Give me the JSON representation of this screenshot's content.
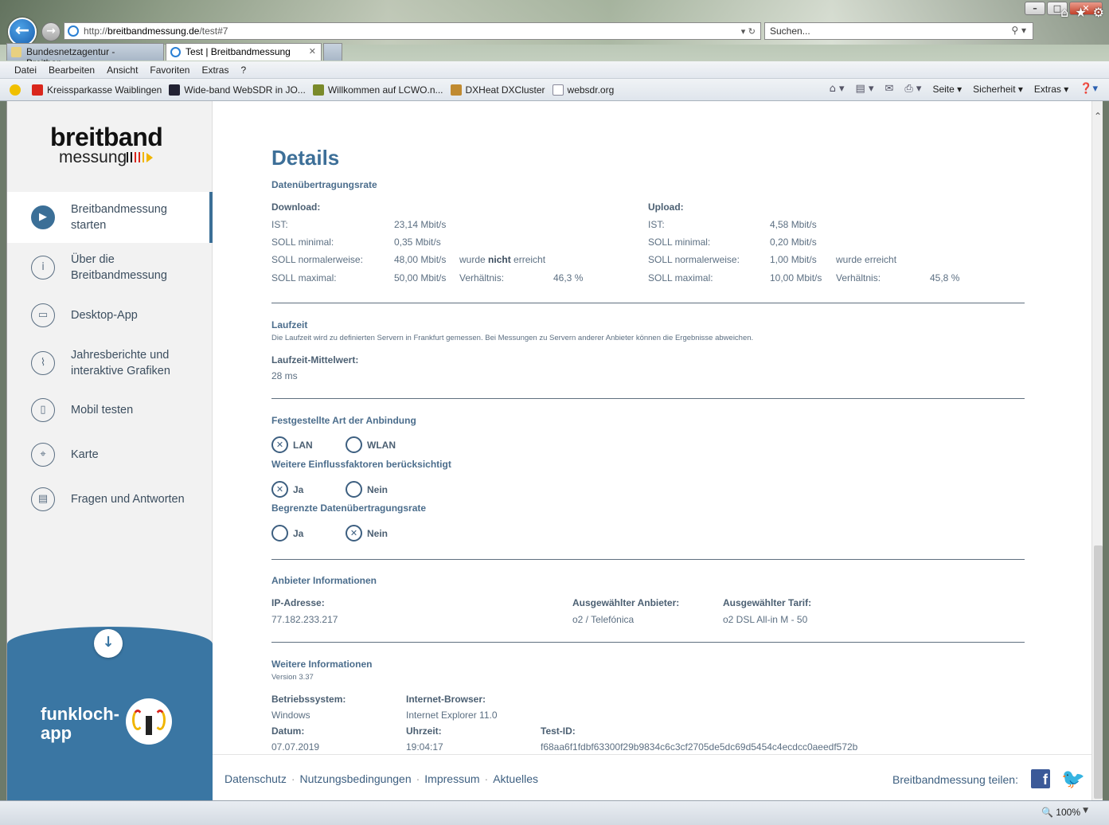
{
  "browser": {
    "url_prefix": "http://",
    "url_host": "breitbandmessung.de",
    "url_path": "/test#7",
    "search_placeholder": "Suchen...",
    "tabs": [
      {
        "label": "Bundesnetzagentur - Breitban...",
        "active": false
      },
      {
        "label": "Test | Breitbandmessung",
        "active": true
      }
    ],
    "menu": [
      "Datei",
      "Bearbeiten",
      "Ansicht",
      "Favoriten",
      "Extras",
      "?"
    ],
    "favorites": [
      "Kreissparkasse Waiblingen",
      "Wide-band WebSDR in JO...",
      "Willkommen auf LCWO.n...",
      "DXHeat  DXCluster",
      "websdr.org"
    ],
    "command_bar": [
      "Seite",
      "Sicherheit",
      "Extras"
    ],
    "zoom": "100%"
  },
  "sidebar": {
    "logo_top": "breitband",
    "logo_bottom": "messung",
    "items": [
      {
        "label1": "Breitbandmessung",
        "label2": "starten",
        "icon": "play-icon"
      },
      {
        "label1": "Über die",
        "label2": "Breitbandmessung",
        "icon": "info-icon"
      },
      {
        "label1": "Desktop-App",
        "label2": "",
        "icon": "monitor-icon"
      },
      {
        "label1": "Jahresberichte und",
        "label2": "interaktive Grafiken",
        "icon": "chart-icon"
      },
      {
        "label1": "Mobil testen",
        "label2": "",
        "icon": "mobile-icon"
      },
      {
        "label1": "Karte",
        "label2": "",
        "icon": "map-pin-icon"
      },
      {
        "label1": "Fragen und Antworten",
        "label2": "",
        "icon": "chat-icon"
      }
    ],
    "funkloch_line1": "funkloch-",
    "funkloch_line2": "app"
  },
  "details": {
    "title": "Details",
    "rate_title": "Datenübertragungsrate",
    "download": {
      "heading": "Download:",
      "ist_label": "IST:",
      "ist": "23,14 Mbit/s",
      "min_label": "SOLL minimal:",
      "min": "0,35 Mbit/s",
      "normal_label": "SOLL normalerweise:",
      "normal": "48,00 Mbit/s",
      "normal_note_pre": "wurde ",
      "normal_note_bold": "nicht",
      "normal_note_post": " erreicht",
      "max_label": "SOLL maximal:",
      "max": "50,00 Mbit/s",
      "ratio_label": "Verhältnis:",
      "ratio": "46,3 %"
    },
    "upload": {
      "heading": "Upload:",
      "ist_label": "IST:",
      "ist": "4,58 Mbit/s",
      "min_label": "SOLL minimal:",
      "min": "0,20 Mbit/s",
      "normal_label": "SOLL normalerweise:",
      "normal": "1,00 Mbit/s",
      "normal_note": "wurde erreicht",
      "max_label": "SOLL maximal:",
      "max": "10,00 Mbit/s",
      "ratio_label": "Verhältnis:",
      "ratio": "45,8 %"
    },
    "latency_title": "Laufzeit",
    "latency_note": "Die Laufzeit wird zu definierten Servern in Frankfurt gemessen. Bei Messungen zu Servern anderer Anbieter können die Ergebnisse abweichen.",
    "latency_label": "Laufzeit-Mittelwert:",
    "latency_value": "28 ms",
    "connection_title": "Festgestellte Art der Anbindung",
    "conn_lan": "LAN",
    "conn_wlan": "WLAN",
    "factors_title": "Weitere Einflussfaktoren berücksichtigt",
    "factors_yes": "Ja",
    "factors_no": "Nein",
    "limited_title": "Begrenzte Datenübertragungsrate",
    "limited_yes": "Ja",
    "limited_no": "Nein",
    "provider_title": "Anbieter Informationen",
    "ip_label": "IP-Adresse:",
    "ip": "77.182.233.217",
    "provider_label": "Ausgewählter Anbieter:",
    "provider": "o2 / Telefónica",
    "tariff_label": "Ausgewählter Tarif:",
    "tariff": "o2 DSL All-in M - 50",
    "more_title": "Weitere Informationen",
    "version": "Version 3.37",
    "os_label": "Betriebssystem:",
    "os": "Windows",
    "browser_label": "Internet-Browser:",
    "browser": "Internet Explorer 11.0",
    "date_label": "Datum:",
    "date": "07.07.2019",
    "time_label": "Uhrzeit:",
    "time": "19:04:17",
    "testid_label": "Test-ID:",
    "testid": "f68aa6f1fdbf63300f29b9834c6c3cf2705de5dc69d5454c4ecdcc0aeedf572b"
  },
  "footer": {
    "links": [
      "Datenschutz",
      "Nutzungsbedingungen",
      "Impressum",
      "Aktuelles"
    ],
    "share": "Breitbandmessung teilen:"
  },
  "colors": {
    "accent": "#3d6f98",
    "sidebar_blue": "#3a76a3",
    "text": "#5c6f82"
  }
}
